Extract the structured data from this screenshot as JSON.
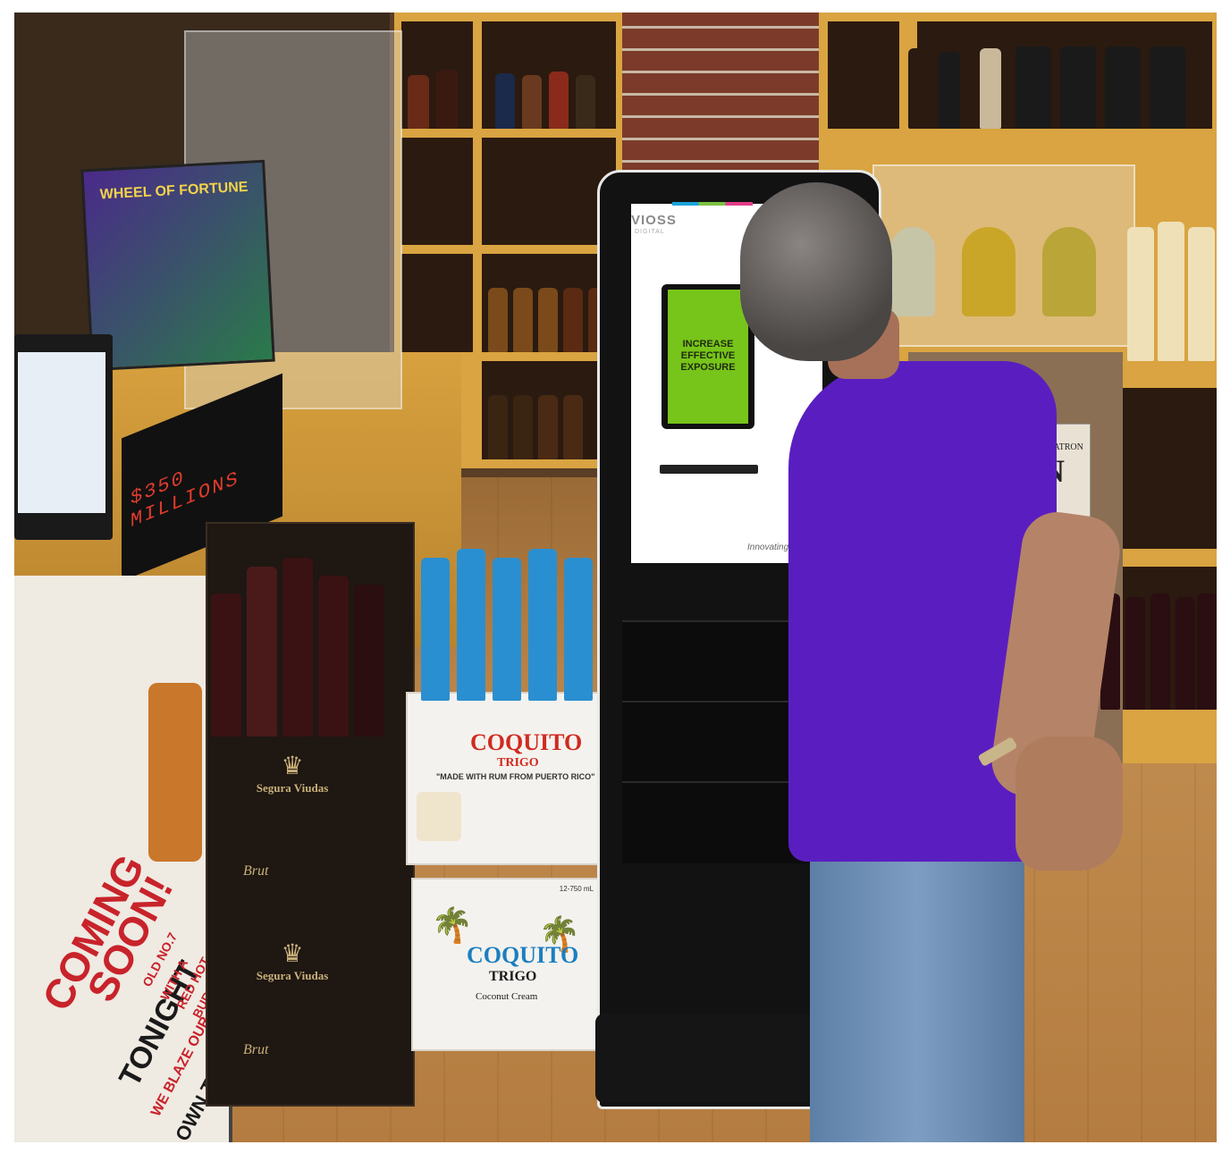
{
  "scene": {
    "description_labels": {
      "kiosk_brand": "VIOSS",
      "kiosk_brand_sub": "DIGITAL",
      "kiosk_screen_message": [
        "INCREASE",
        "EFFECTIVE",
        "EXPOSURE"
      ],
      "kiosk_tagline": "Innovating",
      "poster_heading": [
        "COMING",
        "SOON!"
      ],
      "poster_sub": [
        "TONIGHT",
        "WE BLAZE OUR",
        "OWN TRAIL"
      ],
      "poster_side": [
        "OLD NO.7",
        "WITH A",
        "RED HOT",
        "BURN"
      ],
      "lottery_title": "WHEEL OF FORTUNE",
      "ticker_text": "$350 MILLIONS",
      "box_brand": "Segura Viudas",
      "box_brand_2": "Brut",
      "coquito_box_title": "COQUITO",
      "coquito_box_sub": "TRIGO",
      "coquito_box_claim": "\"MADE WITH RUM FROM PUERTO RICO\"",
      "coquito_box_bottom": "COQUITO",
      "coquito_box_bottom_sub": "TRIGO",
      "coquito_box_bottom_small": "Coconut Cream",
      "coquito_count": "12-750 mL",
      "shelf_label": "ROCA PATRON",
      "shelf_label_n": "N"
    }
  },
  "colors": {
    "shirt": "#5a1ec0",
    "kiosk_screen_green": "#77c41a",
    "shelf_wood": "#d9a441"
  }
}
